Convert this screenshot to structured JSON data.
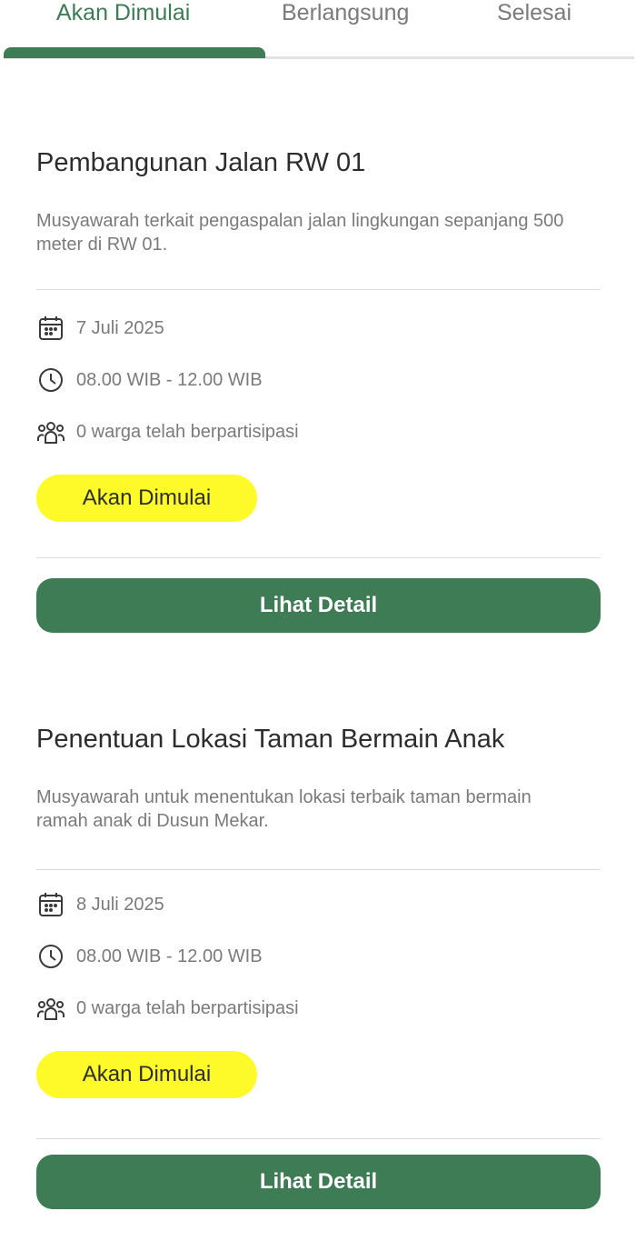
{
  "tabs": [
    {
      "label": "Akan Dimulai",
      "active": true
    },
    {
      "label": "Berlangsung",
      "active": false
    },
    {
      "label": "Selesai",
      "active": false
    }
  ],
  "cards": [
    {
      "title": "Pembangunan Jalan RW 01",
      "description": "Musyawarah terkait pengaspalan jalan lingkungan sepanjang 500 meter di RW 01.",
      "date": "7 Juli 2025",
      "time": "08.00 WIB - 12.00 WIB",
      "participants": "0 warga telah berpartisipasi",
      "status": "Akan Dimulai",
      "button": "Lihat Detail"
    },
    {
      "title": "Penentuan Lokasi Taman Bermain Anak",
      "description": "Musyawarah untuk menentukan lokasi terbaik taman bermain ramah anak di Dusun Mekar.",
      "date": "8 Juli 2025",
      "time": "08.00 WIB - 12.00 WIB",
      "participants": "0 warga telah berpartisipasi",
      "status": "Akan Dimulai",
      "button": "Lihat Detail"
    }
  ],
  "colors": {
    "primary_green": "#3d7c54",
    "status_yellow": "#fefa2a",
    "muted_text": "#7a7a7a"
  },
  "icons": [
    "calendar-icon",
    "clock-icon",
    "people-icon"
  ]
}
